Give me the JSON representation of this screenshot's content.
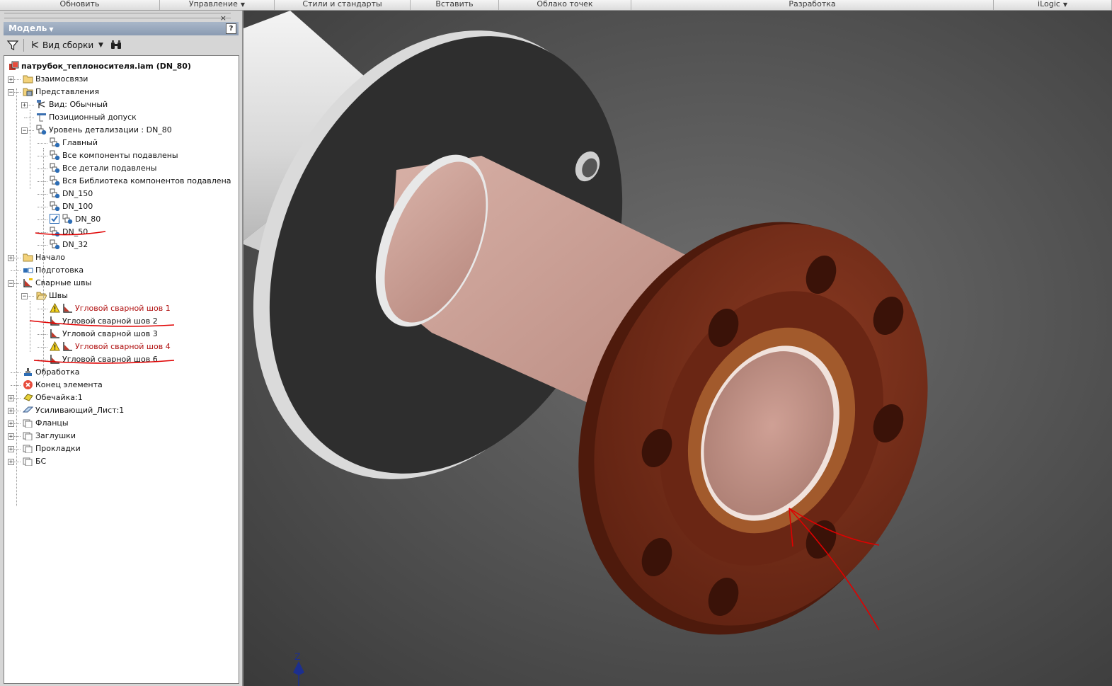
{
  "ribbon": {
    "tabs": [
      {
        "label": "Обновить",
        "dropdown": false
      },
      {
        "label": "Управление",
        "dropdown": true
      },
      {
        "label": "Стили и стандарты",
        "dropdown": false
      },
      {
        "label": "Вставить",
        "dropdown": false
      },
      {
        "label": "Облако точек",
        "dropdown": false
      },
      {
        "label": "Разработка",
        "dropdown": false
      },
      {
        "label": "iLogic",
        "dropdown": true
      }
    ]
  },
  "browser": {
    "title": "Модель",
    "help": "?",
    "close": "×",
    "view_label": "Вид сборки",
    "tree": [
      {
        "label": "патрубок_теплоносителя.iam (DN_80)",
        "level": 0,
        "icon": "assembly-icon",
        "bold": true
      },
      {
        "label": "Взаимосвязи",
        "level": 0,
        "icon": "folder-icon",
        "toggle": "+"
      },
      {
        "label": "Представления",
        "level": 0,
        "icon": "representations-icon",
        "toggle": "-"
      },
      {
        "label": "Вид: Обычный",
        "level": 1,
        "icon": "view-rep-icon",
        "toggle": "+"
      },
      {
        "label": "Позиционный допуск",
        "level": 1,
        "icon": "position-icon"
      },
      {
        "label": "Уровень детализации : DN_80",
        "level": 1,
        "icon": "lod-icon",
        "toggle": "-"
      },
      {
        "label": "Главный",
        "level": 2,
        "icon": "lod-icon"
      },
      {
        "label": "Все компоненты подавлены",
        "level": 2,
        "icon": "lod-icon"
      },
      {
        "label": "Все детали подавлены",
        "level": 2,
        "icon": "lod-icon"
      },
      {
        "label": "Вся Библиотека компонентов подавлена",
        "level": 2,
        "icon": "lod-icon"
      },
      {
        "label": "DN_150",
        "level": 2,
        "icon": "lod-icon"
      },
      {
        "label": "DN_100",
        "level": 2,
        "icon": "lod-icon"
      },
      {
        "label": "DN_80",
        "level": 2,
        "icon": "lod-icon",
        "checked": true
      },
      {
        "label": "DN_50",
        "level": 2,
        "icon": "lod-icon"
      },
      {
        "label": "DN_32",
        "level": 2,
        "icon": "lod-icon"
      },
      {
        "label": "Начало",
        "level": 0,
        "icon": "folder-icon",
        "toggle": "+"
      },
      {
        "label": "Подготовка",
        "level": 0,
        "icon": "preparation-icon"
      },
      {
        "label": "Сварные швы",
        "level": 0,
        "icon": "weld-icon",
        "toggle": "-"
      },
      {
        "label": "Швы",
        "level": 1,
        "icon": "open-folder-icon",
        "toggle": "-"
      },
      {
        "label": "Угловой сварной шов 1",
        "level": 2,
        "icon": "fillet-weld-icon",
        "warning": true
      },
      {
        "label": "Угловой сварной шов 2",
        "level": 2,
        "icon": "fillet-weld-icon"
      },
      {
        "label": "Угловой сварной шов 3",
        "level": 2,
        "icon": "fillet-weld-icon"
      },
      {
        "label": "Угловой сварной шов 4",
        "level": 2,
        "icon": "fillet-weld-icon",
        "warning": true
      },
      {
        "label": "Угловой сварной шов 6",
        "level": 2,
        "icon": "fillet-weld-icon"
      },
      {
        "label": "Обработка",
        "level": 0,
        "icon": "machining-icon"
      },
      {
        "label": "Конец элемента",
        "level": 0,
        "icon": "end-of-features-icon"
      },
      {
        "label": "Обечайка:1",
        "level": 0,
        "icon": "part-icon",
        "toggle": "+"
      },
      {
        "label": "Усиливающий_Лист:1",
        "level": 0,
        "icon": "sheet-part-icon",
        "toggle": "+"
      },
      {
        "label": "Фланцы",
        "level": 0,
        "icon": "pattern-folder-icon",
        "toggle": "+"
      },
      {
        "label": "Заглушки",
        "level": 0,
        "icon": "pattern-folder-icon",
        "toggle": "+"
      },
      {
        "label": "Прокладки",
        "level": 0,
        "icon": "pattern-folder-icon",
        "toggle": "+"
      },
      {
        "label": "БС",
        "level": 0,
        "icon": "pattern-folder-icon",
        "toggle": "+"
      }
    ]
  },
  "viewcube": {
    "axis_label": "Z"
  },
  "colors": {
    "flange": "#7a2c18",
    "plate": "#2e2e2e",
    "tube": "#c49a90",
    "pipe": "#e2e2e2",
    "annotation": "#e00000",
    "error_text": "#b01010",
    "axis": "#1c2f8f"
  }
}
